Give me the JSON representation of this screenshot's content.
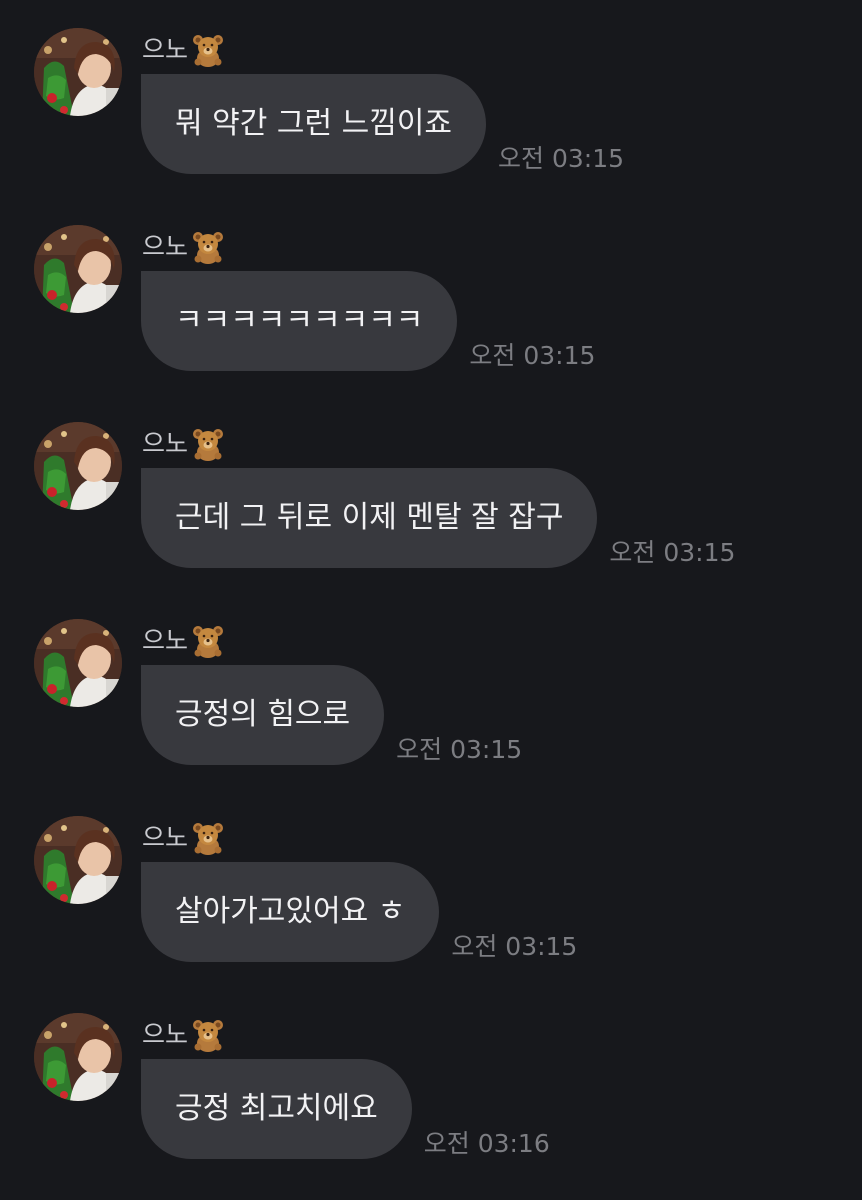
{
  "sender": {
    "name": "으노",
    "emoji_icon": "teddy-bear-icon"
  },
  "messages": [
    {
      "text": "뭐 약간 그런 느낌이죠",
      "time": "오전 03:15"
    },
    {
      "text": "ㅋㅋㅋㅋㅋㅋㅋㅋㅋ",
      "time": "오전 03:15"
    },
    {
      "text": "근데 그 뒤로 이제 멘탈 잘 잡구",
      "time": "오전 03:15"
    },
    {
      "text": "긍정의 힘으로",
      "time": "오전 03:15"
    },
    {
      "text": "살아가고있어요 ㅎ",
      "time": "오전 03:15"
    },
    {
      "text": "긍정 최고치에요",
      "time": "오전 03:16"
    }
  ],
  "colors": {
    "background": "#17181c",
    "bubble": "#38393e",
    "bubble_text": "#f2f2f4",
    "timestamp": "#7c7d82",
    "sender_name": "#c9cacf"
  }
}
